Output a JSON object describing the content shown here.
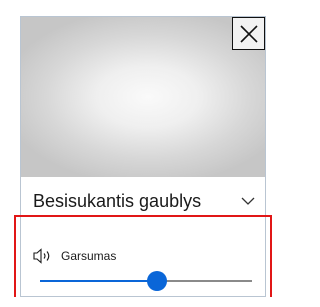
{
  "preview": {
    "close_icon": "close-icon"
  },
  "dropdown": {
    "selected": "Besisukantis gaublys",
    "chevron_icon": "chevron-down-icon"
  },
  "volume": {
    "icon": "speaker-icon",
    "label": "Garsumas",
    "level": 0.55
  },
  "colors": {
    "accent": "#0a66d8",
    "highlight_border": "#e11616"
  }
}
